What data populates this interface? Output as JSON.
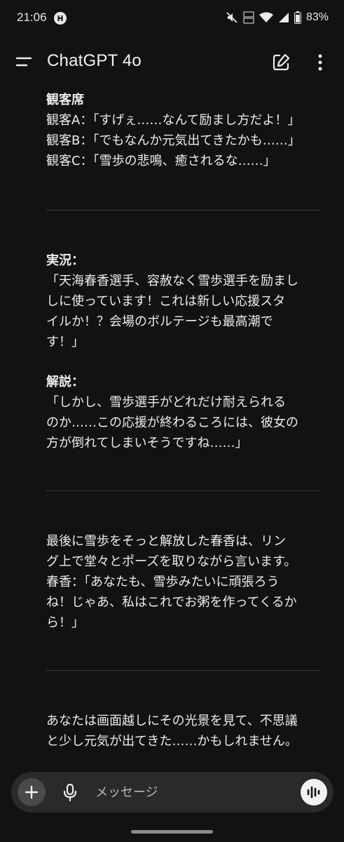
{
  "status_bar": {
    "time": "21:06",
    "battery": "83%"
  },
  "header": {
    "title": "ChatGPT 4o"
  },
  "messages": {
    "audience": {
      "heading": "観客席",
      "lines": [
        "観客A：「すげぇ……なんて励まし方だよ！」",
        "観客B：「でもなんか元気出てきたかも……」",
        "観客C：「雪歩の悲鳴、癒されるな……」"
      ]
    },
    "commentary": {
      "heading": "実況：",
      "lines": [
        "「天海春香選手、容赦なく雪歩選手を励まし",
        "しに使っています！これは新しい応援スタ",
        "イルか！？会場のボルテージも最高潮で",
        "す！」"
      ]
    },
    "analysis": {
      "heading": "解説：",
      "lines": [
        "「しかし、雪歩選手がどれだけ耐えられる",
        "のか……この応援が終わるころには、彼女の",
        "方が倒れてしまいそうですね……」"
      ]
    },
    "narration": {
      "lines": [
        "最後に雪歩をそっと解放した春香は、リン",
        "グ上で堂々とポーズを取りながら言います。",
        "春香：「あなたも、雪歩みたいに頑張ろう",
        "ね！じゃあ、私はこれでお粥を作ってくるか",
        "ら！」"
      ]
    },
    "ending": {
      "lines": [
        "あなたは画面越しにその光景を見て、不思議",
        "と少し元気が出てきた……かもしれません。"
      ]
    }
  },
  "input_bar": {
    "placeholder": "メッセージ"
  },
  "icons": {
    "menu": "menu-icon",
    "new_chat": "edit-icon",
    "more": "more-vert-icon",
    "plus": "plus-icon",
    "mic": "mic-icon",
    "voice": "voice-waveform-icon"
  },
  "colors": {
    "background": "#121212",
    "text": "#ececec",
    "input_bar": "#2a2a2a",
    "divider": "#3a3a3a"
  }
}
